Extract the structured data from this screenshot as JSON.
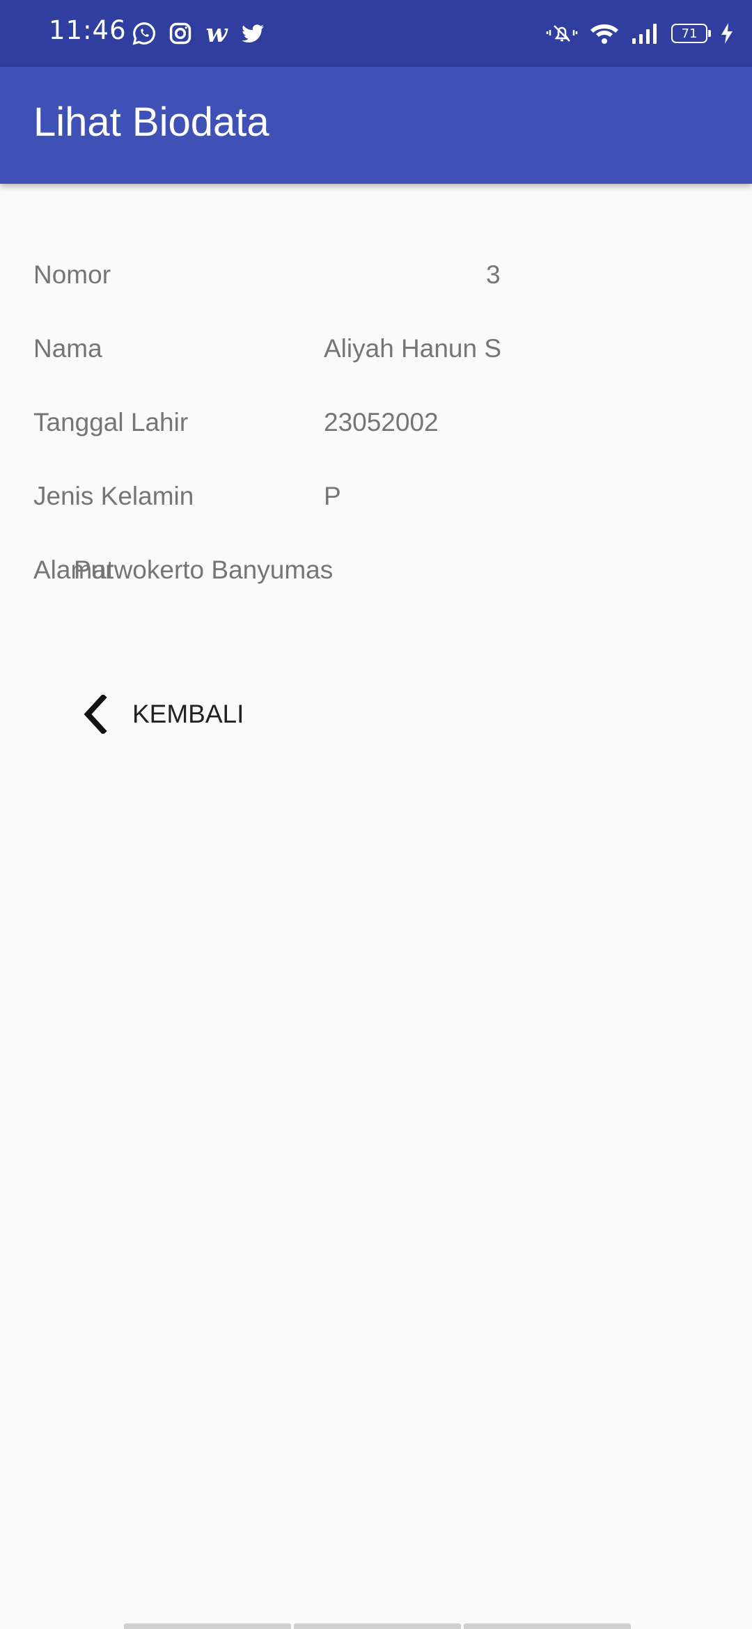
{
  "status_bar": {
    "time": "11:46",
    "notification_icons": [
      "whatsapp-icon",
      "instagram-icon",
      "webtoon-icon",
      "twitter-icon"
    ],
    "webtoon_glyph": "w",
    "battery_level": "71",
    "system_icons": [
      "mute-icon",
      "wifi-icon",
      "signal-icon",
      "battery-icon",
      "charging-icon"
    ]
  },
  "app_bar": {
    "title": "Lihat Biodata",
    "color": "#3f51b5",
    "status_color": "#303f9f"
  },
  "biodata": {
    "nomor": {
      "label": "Nomor",
      "value": "3"
    },
    "nama": {
      "label": "Nama",
      "value": "Aliyah Hanun S"
    },
    "tanggal_lahir": {
      "label": "Tanggal Lahir",
      "value": "23052002"
    },
    "jenis_kelamin": {
      "label": "Jenis Kelamin",
      "value": "P"
    },
    "alamat": {
      "label": "Alamat",
      "value": "Purwokerto Banyumas"
    }
  },
  "back_button": {
    "label": "KEMBALI",
    "icon": "chevron-left-icon"
  }
}
